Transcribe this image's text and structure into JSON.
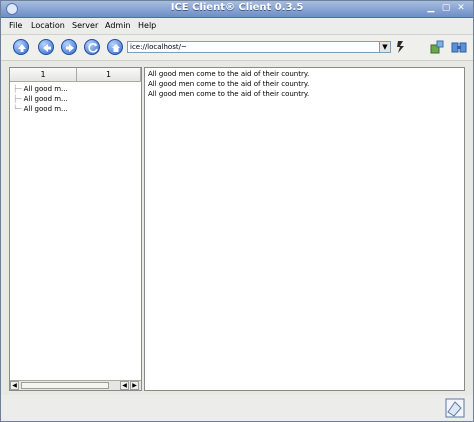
{
  "window": {
    "title": "ICE Client® Client 0.3.5",
    "accent_color": "#6d8dc6"
  },
  "menubar": {
    "items": [
      {
        "label": "File"
      },
      {
        "label": "Location"
      },
      {
        "label": "Server"
      },
      {
        "label": "Admin"
      },
      {
        "label": "Help"
      }
    ]
  },
  "toolbar": {
    "nav_buttons": [
      "up-arrow-icon",
      "back-arrow-icon",
      "forward-arrow-icon",
      "refresh-icon",
      "home-icon"
    ],
    "url_value": "ice://localhost/~",
    "go_icon": "go-icon",
    "tool_icons": [
      "plugin-icon",
      "tools-icon"
    ]
  },
  "left_pane": {
    "columns": [
      "1",
      "1"
    ],
    "items": [
      "All good m...",
      "All good m...",
      "All good m..."
    ]
  },
  "content": {
    "lines": [
      "All good men come to the aid of their country.",
      "All good men come to the aid of their country.",
      "All good men come to the aid of their country."
    ]
  },
  "statusbar": {
    "icon": "status-icon"
  }
}
